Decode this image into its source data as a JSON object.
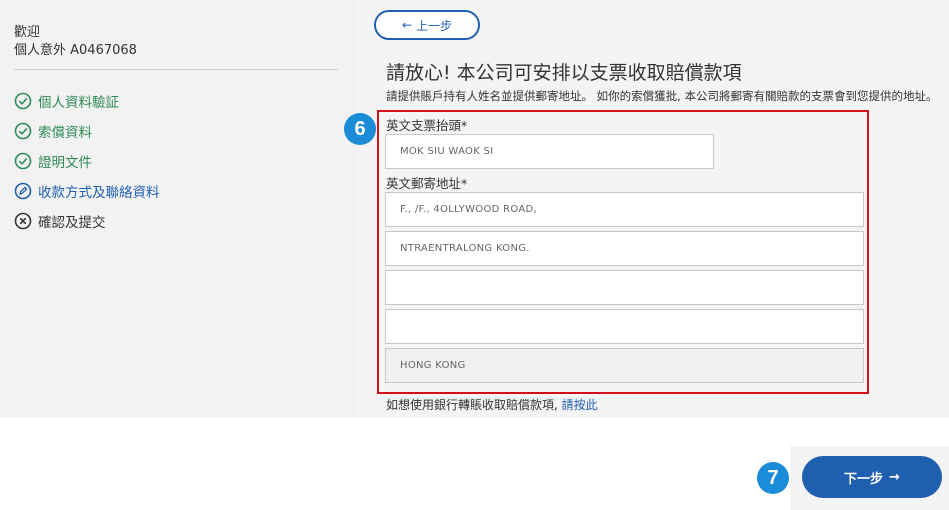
{
  "sidebar": {
    "welcome": "歡迎",
    "policy": "個人意外 A0467068",
    "steps": [
      {
        "label": "個人資料驗証",
        "status": "done"
      },
      {
        "label": "索償資料",
        "status": "done"
      },
      {
        "label": "證明文件",
        "status": "done"
      },
      {
        "label": "收款方式及聯絡資料",
        "status": "active"
      },
      {
        "label": "確認及提交",
        "status": "pending"
      }
    ]
  },
  "main": {
    "back_label": "上一步",
    "title": "請放心! 本公司可安排以支票收取賠償款項",
    "subtitle": "請提供賬戶持有人姓名並提供郵寄地址。 如你的索償獲批, 本公司將郵寄有關賠款的支票會到您提供的地址。",
    "form": {
      "badge": "6",
      "payee_label": "英文支票抬頭*",
      "payee_value": "MOK SIU WAOK SI",
      "address_label": "英文郵寄地址*",
      "address_lines": [
        "F., /F., 4OLLYWOOD ROAD,",
        "NTRAENTRALONG KONG.",
        "",
        "",
        "HONG KONG"
      ]
    },
    "bank_note": "如想使用銀行轉賬收取賠償款項,",
    "bank_link": "請按此"
  },
  "footer": {
    "badge": "7",
    "next_label": "下一步"
  }
}
